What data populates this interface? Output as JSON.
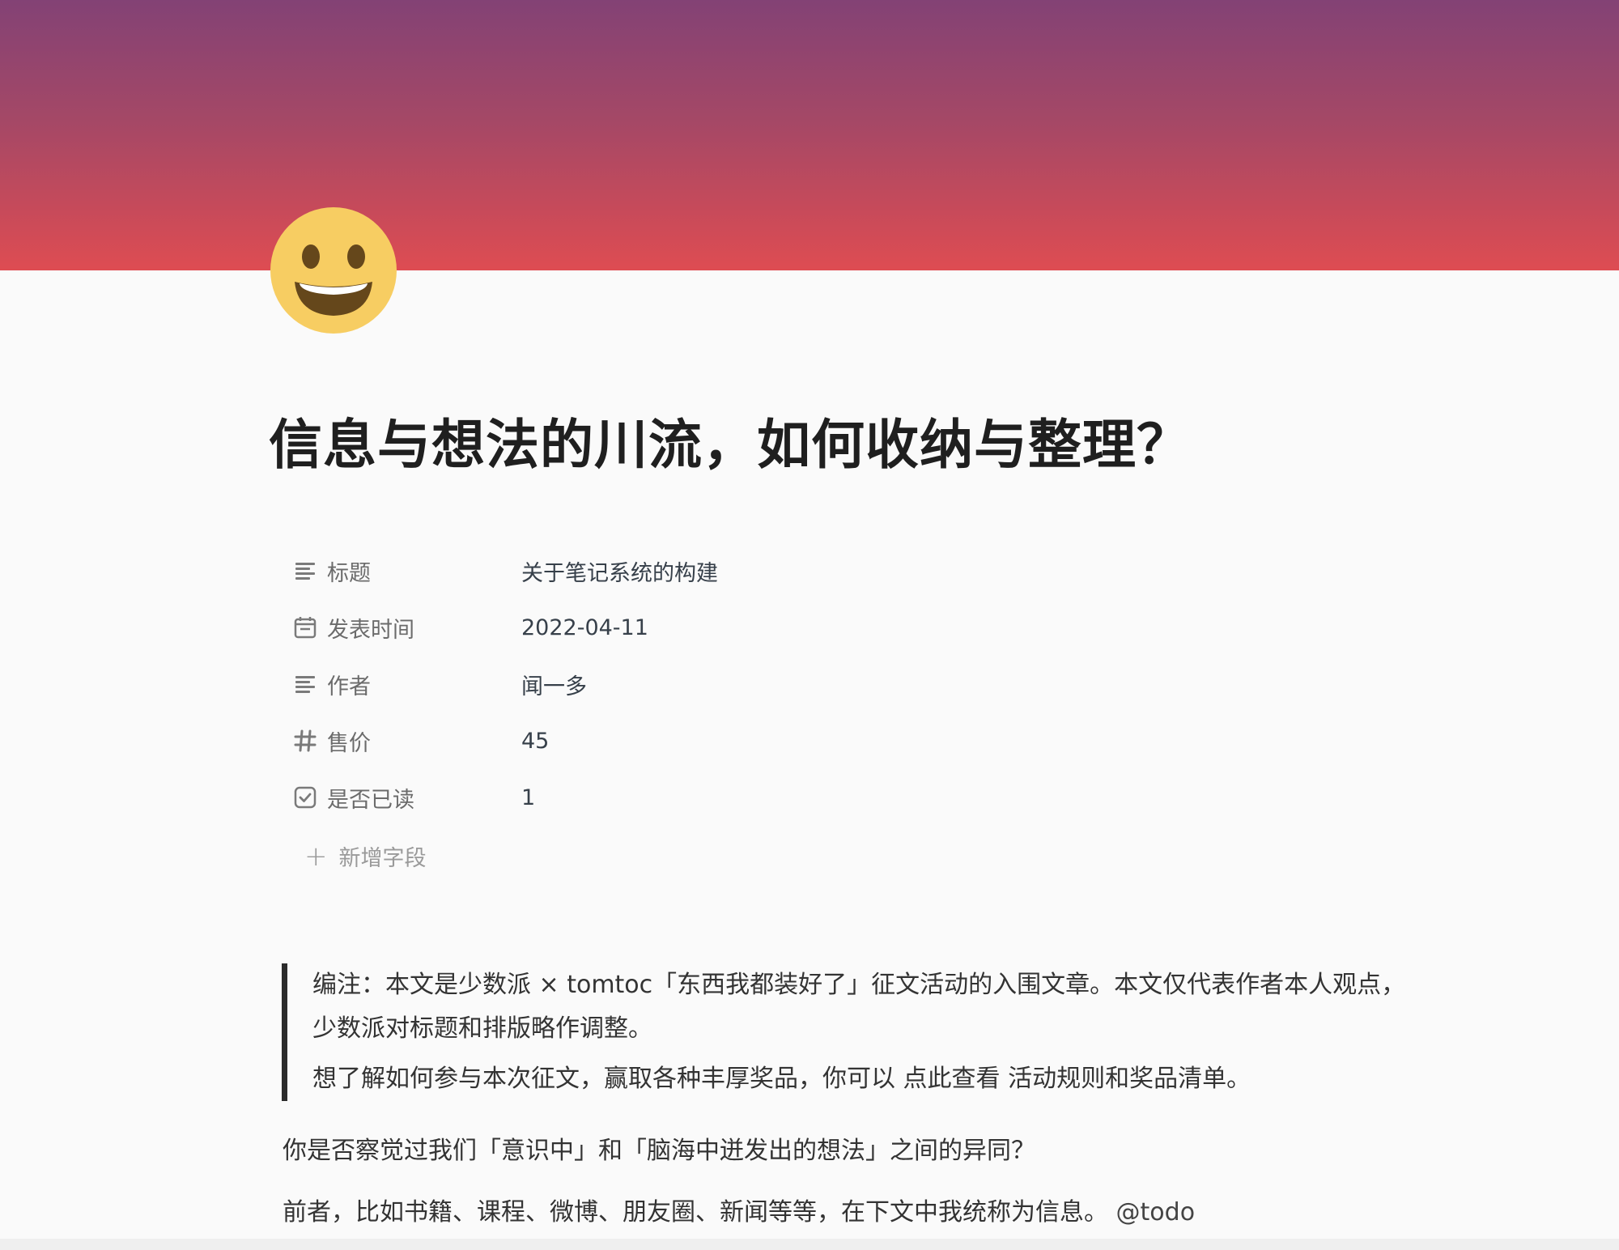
{
  "cover": {
    "gradient_top": "#834275",
    "gradient_bottom": "#de4c52"
  },
  "page_icon": "grinning-face-emoji",
  "title": "信息与想法的川流，如何收纳与整理？",
  "properties": [
    {
      "icon": "text-lines-icon",
      "key": "标题",
      "value": "关于笔记系统的构建"
    },
    {
      "icon": "calendar-icon",
      "key": "发表时间",
      "value": "2022-04-11"
    },
    {
      "icon": "text-lines-icon",
      "key": "作者",
      "value": "闻一多"
    },
    {
      "icon": "hash-icon",
      "key": "售价",
      "value": "45"
    },
    {
      "icon": "checkbox-icon",
      "key": "是否已读",
      "value": "1"
    }
  ],
  "add_field_label": "新增字段",
  "quote": {
    "line1": "编注：本文是少数派 × tomtoc「东西我都装好了」征文活动的入围文章。本文仅代表作者本人观点，少数派对标题和排版略作调整。",
    "line2": "想了解如何参与本次征文，赢取各种丰厚奖品，你可以 点此查看 活动规则和奖品清单。"
  },
  "paragraphs": {
    "p1": "你是否察觉过我们「意识中」和「脑海中迸发出的想法」之间的异同？",
    "p2": "前者，比如书籍、课程、微博、朋友圈、新闻等等，在下文中我统称为信息。",
    "p2_mention": "@todo"
  }
}
